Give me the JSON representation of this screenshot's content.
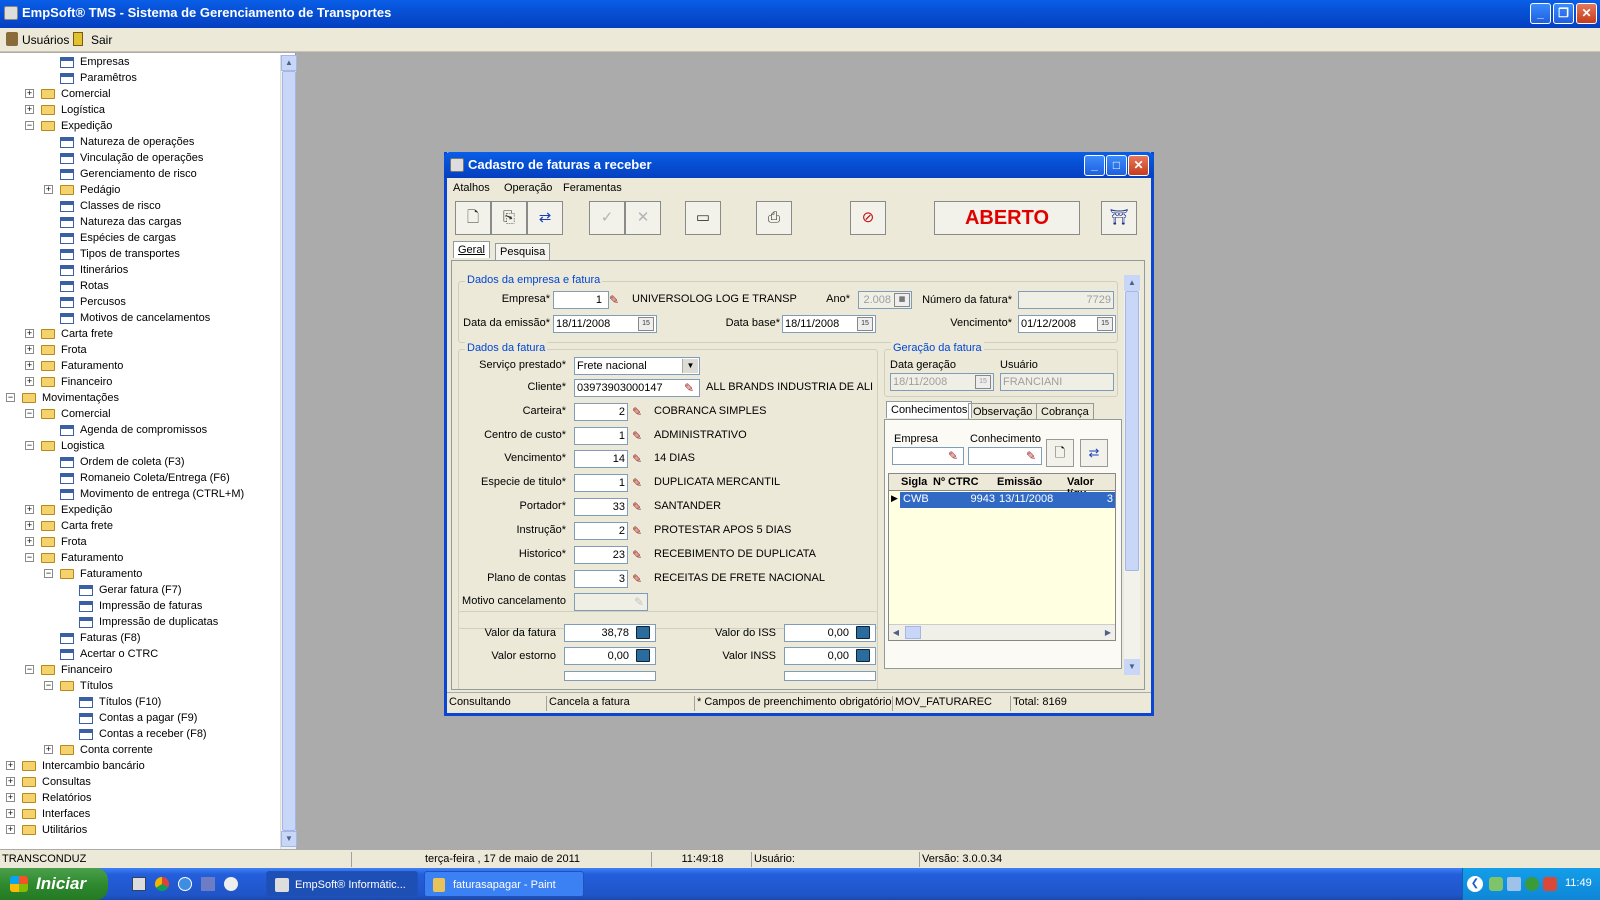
{
  "app": {
    "title": "EmpSoft® TMS - Sistema de Gerenciamento de Transportes",
    "menu": {
      "users": "Usuários",
      "exit": "Sair"
    }
  },
  "tree": [
    {
      "label": "Empresas",
      "level": 3,
      "kind": "doc"
    },
    {
      "label": "Paramêtros",
      "level": 3,
      "kind": "doc"
    },
    {
      "label": "Comercial",
      "level": 2,
      "kind": "folder",
      "exp": "+"
    },
    {
      "label": "Logística",
      "level": 2,
      "kind": "folder",
      "exp": "+"
    },
    {
      "label": "Expedição",
      "level": 2,
      "kind": "folder",
      "exp": "-"
    },
    {
      "label": "Natureza de operações",
      "level": 3,
      "kind": "doc"
    },
    {
      "label": "Vinculação de operações",
      "level": 3,
      "kind": "doc"
    },
    {
      "label": "Gerenciamento de risco",
      "level": 3,
      "kind": "doc"
    },
    {
      "label": "Pedágio",
      "level": 3,
      "kind": "folder",
      "exp": "+"
    },
    {
      "label": "Classes de risco",
      "level": 3,
      "kind": "doc"
    },
    {
      "label": "Natureza das cargas",
      "level": 3,
      "kind": "doc"
    },
    {
      "label": "Espécies de cargas",
      "level": 3,
      "kind": "doc"
    },
    {
      "label": "Tipos de transportes",
      "level": 3,
      "kind": "doc"
    },
    {
      "label": "Itinerários",
      "level": 3,
      "kind": "doc"
    },
    {
      "label": "Rotas",
      "level": 3,
      "kind": "doc"
    },
    {
      "label": "Percusos",
      "level": 3,
      "kind": "doc"
    },
    {
      "label": "Motivos de cancelamentos",
      "level": 3,
      "kind": "doc"
    },
    {
      "label": "Carta frete",
      "level": 2,
      "kind": "folder",
      "exp": "+"
    },
    {
      "label": "Frota",
      "level": 2,
      "kind": "folder",
      "exp": "+"
    },
    {
      "label": "Faturamento",
      "level": 2,
      "kind": "folder",
      "exp": "+"
    },
    {
      "label": "Financeiro",
      "level": 2,
      "kind": "folder",
      "exp": "+"
    },
    {
      "label": "Movimentações",
      "level": 1,
      "kind": "folder",
      "exp": "-"
    },
    {
      "label": "Comercial",
      "level": 2,
      "kind": "folder",
      "exp": "-"
    },
    {
      "label": "Agenda de compromissos",
      "level": 3,
      "kind": "doc"
    },
    {
      "label": "Logistica",
      "level": 2,
      "kind": "folder",
      "exp": "-"
    },
    {
      "label": "Ordem de coleta (F3)",
      "level": 3,
      "kind": "doc"
    },
    {
      "label": "Romaneio Coleta/Entrega (F6)",
      "level": 3,
      "kind": "doc"
    },
    {
      "label": "Movimento de entrega (CTRL+M)",
      "level": 3,
      "kind": "doc"
    },
    {
      "label": "Expedição",
      "level": 2,
      "kind": "folder",
      "exp": "+"
    },
    {
      "label": "Carta frete",
      "level": 2,
      "kind": "folder",
      "exp": "+"
    },
    {
      "label": "Frota",
      "level": 2,
      "kind": "folder",
      "exp": "+"
    },
    {
      "label": "Faturamento",
      "level": 2,
      "kind": "folder",
      "exp": "-"
    },
    {
      "label": "Faturamento",
      "level": 3,
      "kind": "folder",
      "exp": "-"
    },
    {
      "label": "Gerar fatura (F7)",
      "level": 4,
      "kind": "doc"
    },
    {
      "label": "Impressão de faturas",
      "level": 4,
      "kind": "doc"
    },
    {
      "label": "Impressão de duplicatas",
      "level": 4,
      "kind": "doc"
    },
    {
      "label": "Faturas (F8)",
      "level": 3,
      "kind": "doc"
    },
    {
      "label": "Acertar o CTRC",
      "level": 3,
      "kind": "doc"
    },
    {
      "label": "Financeiro",
      "level": 2,
      "kind": "folder",
      "exp": "-"
    },
    {
      "label": "Títulos",
      "level": 3,
      "kind": "folder",
      "exp": "-"
    },
    {
      "label": "Títulos (F10)",
      "level": 4,
      "kind": "doc"
    },
    {
      "label": "Contas a pagar (F9)",
      "level": 4,
      "kind": "doc"
    },
    {
      "label": "Contas a receber (F8)",
      "level": 4,
      "kind": "doc"
    },
    {
      "label": "Conta corrente",
      "level": 3,
      "kind": "folder",
      "exp": "+"
    },
    {
      "label": "Intercambio bancário",
      "level": 1,
      "kind": "folder",
      "exp": "+"
    },
    {
      "label": "Consultas",
      "level": 1,
      "kind": "folder",
      "exp": "+"
    },
    {
      "label": "Relatórios",
      "level": 1,
      "kind": "folder",
      "exp": "+"
    },
    {
      "label": "Interfaces",
      "level": 1,
      "kind": "folder",
      "exp": "+"
    },
    {
      "label": "Utilitários",
      "level": 1,
      "kind": "folder",
      "exp": "+"
    }
  ],
  "status": {
    "company": "TRANSCONDUZ",
    "date": "terça-feira , 17 de maio de 2011",
    "time": "11:49:18",
    "user": "Usuário:",
    "version": "Versão: 3.0.0.34"
  },
  "dialog": {
    "title": "Cadastro de faturas a receber",
    "menu": [
      "Atalhos",
      "Operação",
      "Feramentas"
    ],
    "status_word": "ABERTO",
    "tabs": [
      "Geral",
      "Pesquisa"
    ],
    "section1": {
      "title": "Dados da empresa e fatura",
      "empresa_label": "Empresa*",
      "empresa_value": "1",
      "empresa_name": "UNIVERSOLOG LOG E TRANSP",
      "ano_label": "Ano*",
      "ano_value": "2.008",
      "numero_label": "Número da fatura*",
      "numero_value": "7729",
      "emissao_label": "Data da emissão*",
      "emissao_value": "18/11/2008",
      "base_label": "Data base*",
      "base_value": "18/11/2008",
      "venc_label": "Vencimento*",
      "venc_value": "01/12/2008"
    },
    "section2": {
      "title": "Dados da fatura",
      "servico_label": "Serviço prestado*",
      "servico_value": "Frete nacional",
      "cliente_label": "Cliente*",
      "cliente_value": "03973903000147",
      "cliente_name": "ALL BRANDS INDUSTRIA DE ALIM",
      "rows": [
        {
          "label": "Carteira*",
          "value": "2",
          "desc": "COBRANCA SIMPLES"
        },
        {
          "label": "Centro de custo*",
          "value": "1",
          "desc": "ADMINISTRATIVO"
        },
        {
          "label": "Vencimento*",
          "value": "14",
          "desc": "14 DIAS"
        },
        {
          "label": "Especie de titulo*",
          "value": "1",
          "desc": "DUPLICATA MERCANTIL"
        },
        {
          "label": "Portador*",
          "value": "33",
          "desc": "SANTANDER"
        },
        {
          "label": "Instrução*",
          "value": "2",
          "desc": "PROTESTAR APOS 5 DIAS"
        },
        {
          "label": "Historico*",
          "value": "23",
          "desc": "RECEBIMENTO DE DUPLICATA"
        },
        {
          "label": "Plano de contas",
          "value": "3",
          "desc": "RECEITAS DE FRETE NACIONAL"
        }
      ],
      "motivo_label": "Motivo cancelamento"
    },
    "values": {
      "valor_fatura_label": "Valor da fatura",
      "valor_fatura": "38,78",
      "valor_iss_label": "Valor do ISS",
      "valor_iss": "0,00",
      "valor_estorno_label": "Valor estorno",
      "valor_estorno": "0,00",
      "valor_inss_label": "Valor INSS",
      "valor_inss": "0,00"
    },
    "geracao": {
      "title": "Geração da fatura",
      "data_label": "Data geração",
      "data_value": "18/11/2008",
      "usuario_label": "Usuário",
      "usuario_value": "FRANCIANI"
    },
    "subtabs": [
      "Conhecimentos",
      "Observação",
      "Cobrança"
    ],
    "conh": {
      "empresa_label": "Empresa",
      "conhecimento_label": "Conhecimento",
      "columns": [
        "Sigla",
        "Nº CTRC",
        "Emissão",
        "Valor líqu"
      ],
      "row": [
        "CWB",
        "9943",
        "13/11/2008",
        "3"
      ]
    },
    "footer": [
      "Consultando",
      "Cancela a fatura",
      "* Campos de preenchimento obrigatório",
      "MOV_FATURAREC",
      "Total: 8169"
    ]
  },
  "taskbar": {
    "start": "Iniciar",
    "items": [
      "EmpSoft® Informátic...",
      "faturasapagar - Paint"
    ],
    "clock": "11:49"
  }
}
